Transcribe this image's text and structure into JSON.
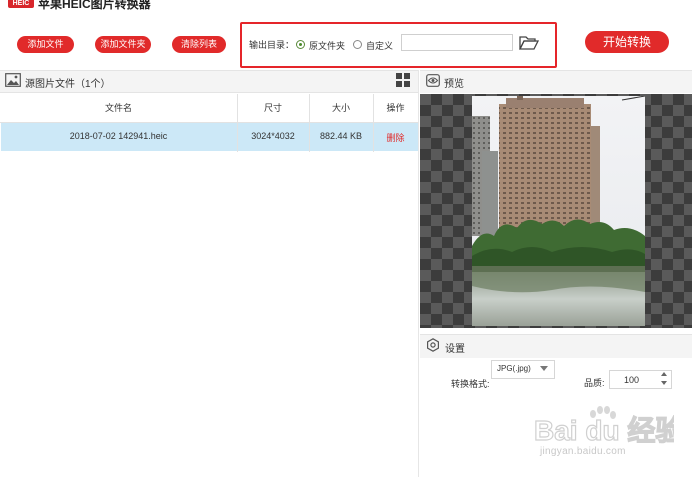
{
  "app": {
    "logo_text": "HEIC",
    "title": "苹果HEIC图片转换器"
  },
  "toolbar": {
    "add_file": "添加文件",
    "add_folder": "添加文件夹",
    "clear_list": "清除列表",
    "start_convert": "开始转换"
  },
  "output": {
    "label": "输出目录：",
    "option_original": "原文件夹",
    "option_custom": "自定义",
    "selected": "原文件夹",
    "path_value": "",
    "folder_icon": "folder-open-icon"
  },
  "source_panel": {
    "title": "源图片文件（1个）",
    "columns": [
      "文件名",
      "尺寸",
      "大小",
      "操作"
    ],
    "rows": [
      {
        "filename": "2018-07-02 142941.heic",
        "dimensions": "3024*4032",
        "size": "882.44 KB",
        "action": "删除"
      }
    ]
  },
  "preview": {
    "title": "预览"
  },
  "settings": {
    "title": "设置",
    "format_label": "转换格式:",
    "format_value": "JPG(.jpg)",
    "quality_label": "品质:",
    "quality_value": "100"
  },
  "watermark": {
    "brand": "Bai du 经验",
    "url": "jingyan.baidu.com"
  },
  "colors": {
    "accent": "#e12a2a",
    "highlight_box": "#e5252a",
    "selected_row": "#cce8f7"
  }
}
